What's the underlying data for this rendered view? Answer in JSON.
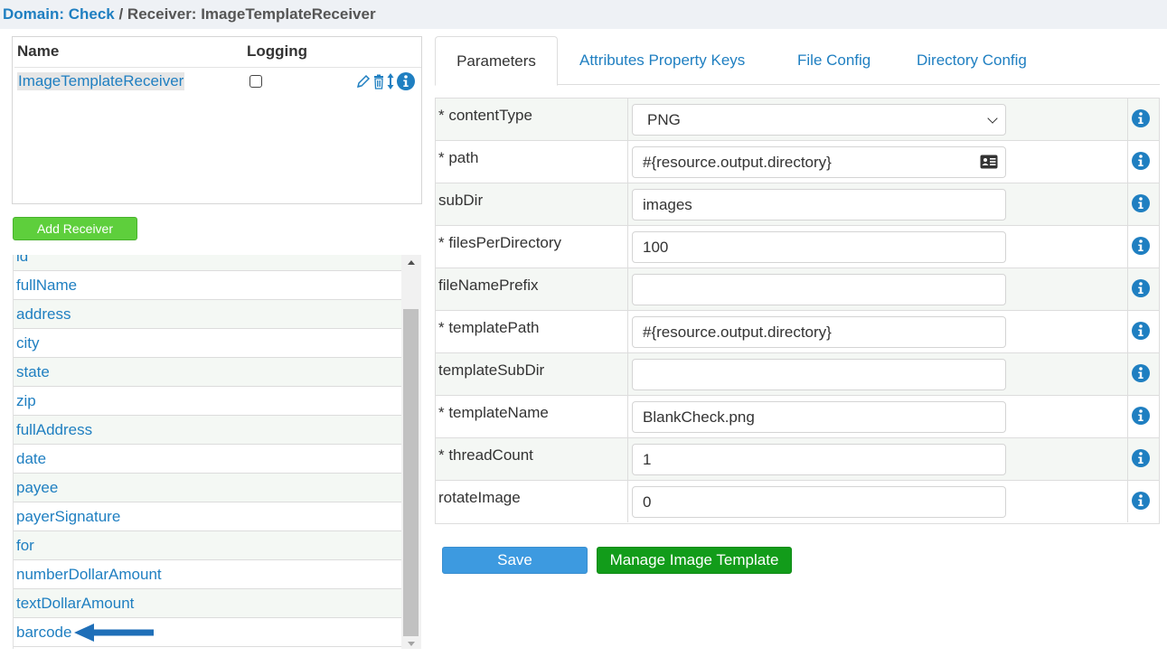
{
  "breadcrumb": {
    "domain_label": "Domain: Check",
    "separator": " / ",
    "receiver_label": "Receiver: ImageTemplateReceiver"
  },
  "receivers_table": {
    "headers": {
      "name": "Name",
      "logging": "Logging"
    },
    "rows": [
      {
        "name": "ImageTemplateReceiver",
        "logging": false
      }
    ],
    "row_icons": [
      "pencil-icon",
      "trash-icon",
      "sort-arrows-icon",
      "info-icon"
    ]
  },
  "add_receiver_label": "Add Receiver",
  "field_list": {
    "items": [
      "id",
      "fullName",
      "address",
      "city",
      "state",
      "zip",
      "fullAddress",
      "date",
      "payee",
      "payerSignature",
      "for",
      "numberDollarAmount",
      "textDollarAmount",
      "barcode"
    ]
  },
  "tabs": {
    "items": [
      "Parameters",
      "Attributes Property Keys",
      "File Config",
      "Directory Config"
    ],
    "active": "Parameters"
  },
  "parameters": [
    {
      "label": "* contentType",
      "type": "select",
      "value": "PNG"
    },
    {
      "label": "* path",
      "type": "text",
      "value": "#{resource.output.directory}",
      "icon": "address-card-icon"
    },
    {
      "label": "subDir",
      "type": "text",
      "value": "images"
    },
    {
      "label": "* filesPerDirectory",
      "type": "text",
      "value": "100"
    },
    {
      "label": "fileNamePrefix",
      "type": "text",
      "value": ""
    },
    {
      "label": "* templatePath",
      "type": "text",
      "value": "#{resource.output.directory}"
    },
    {
      "label": "templateSubDir",
      "type": "text",
      "value": ""
    },
    {
      "label": "* templateName",
      "type": "text",
      "value": "BlankCheck.png"
    },
    {
      "label": "* threadCount",
      "type": "text",
      "value": "1"
    },
    {
      "label": "rotateImage",
      "type": "text",
      "value": "0"
    }
  ],
  "buttons": {
    "save": "Save",
    "manage_image_template": "Manage Image Template"
  },
  "colors": {
    "link": "#1f7fc1",
    "add_button": "#5ecf3c",
    "save_button": "#3d9ae0",
    "manage_button": "#129c1a",
    "info_icon": "#1f7fc1",
    "arrow": "#1f6fb8"
  }
}
